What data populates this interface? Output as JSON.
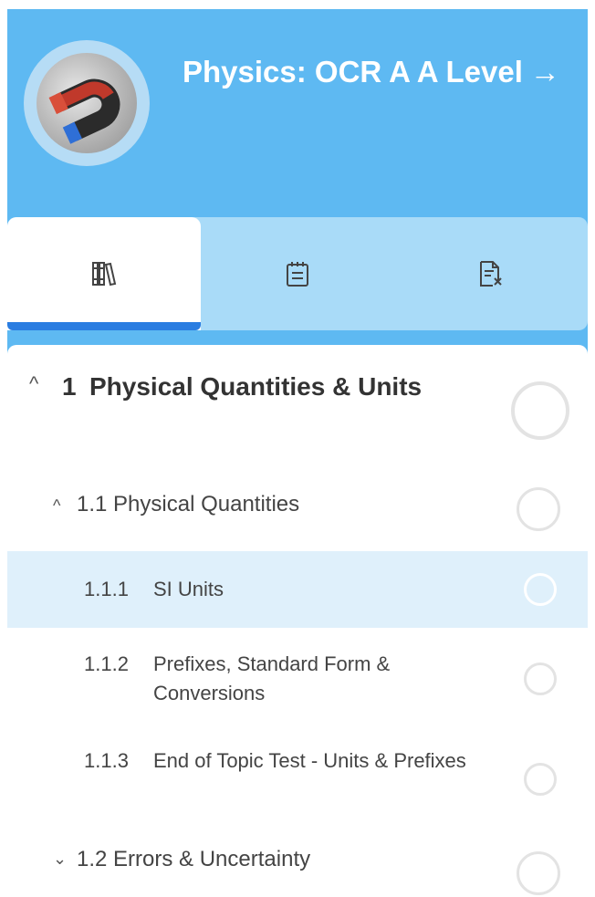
{
  "header": {
    "title": "Physics: OCR A A Level",
    "arrow": "→"
  },
  "tabs": [
    {
      "name": "library-icon",
      "active": true
    },
    {
      "name": "notepad-icon",
      "active": false
    },
    {
      "name": "test-doc-icon",
      "active": false
    }
  ],
  "tree": {
    "topic": {
      "number": "1",
      "label": "Physical Quantities & Units",
      "expander": "^"
    },
    "subtopic1": {
      "number": "1.1",
      "label": "Physical Quantities",
      "expander": "^"
    },
    "items": [
      {
        "number": "1.1.1",
        "label": "SI Units",
        "selected": true
      },
      {
        "number": "1.1.2",
        "label": "Prefixes, Standard Form & Conversions",
        "selected": false
      },
      {
        "number": "1.1.3",
        "label": "End of Topic Test - Units & Prefixes",
        "selected": false
      }
    ],
    "subtopic2": {
      "number": "1.2",
      "label": "Errors & Uncertainty",
      "expander": "⌄"
    }
  }
}
